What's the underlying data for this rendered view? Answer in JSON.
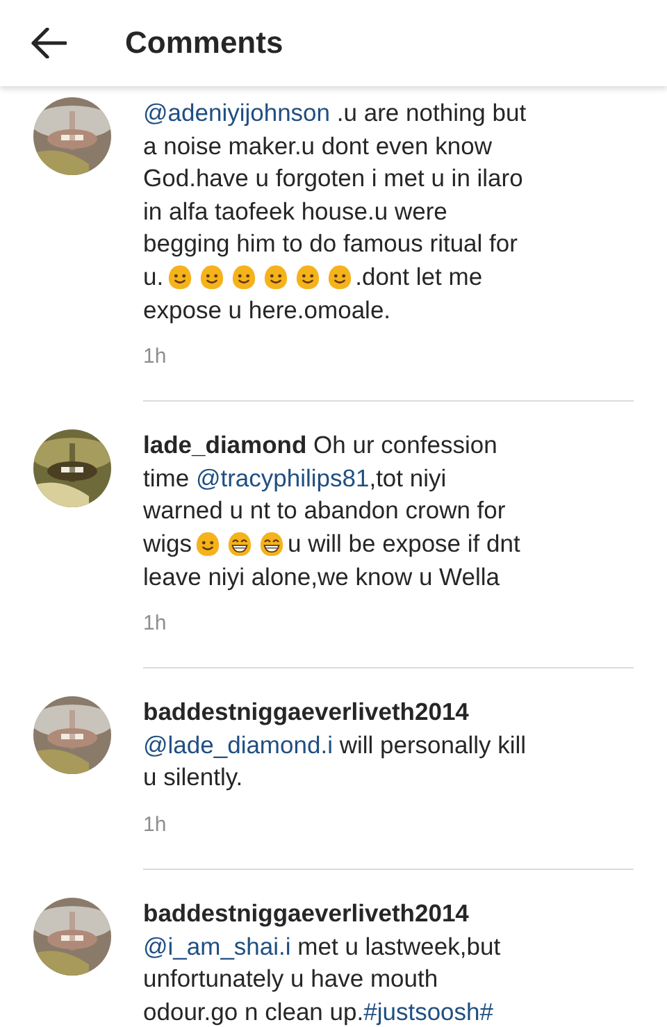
{
  "header": {
    "title": "Comments"
  },
  "comments": [
    {
      "lines": [
        [
          {
            "kind": "mention",
            "text": "@adeniyijohnson"
          },
          {
            "kind": "text",
            "text": " .u are nothing but"
          }
        ],
        [
          {
            "kind": "text",
            "text": "a noise maker.u dont even know"
          }
        ],
        [
          {
            "kind": "text",
            "text": "God.have u forgoten i met u in ilaro"
          }
        ],
        [
          {
            "kind": "text",
            "text": "in alfa taofeek house.u were"
          }
        ],
        [
          {
            "kind": "text",
            "text": "begging him to do famous ritual for"
          }
        ],
        [
          {
            "kind": "text",
            "text": "u."
          },
          {
            "kind": "smile"
          },
          {
            "kind": "smile"
          },
          {
            "kind": "smile"
          },
          {
            "kind": "smile"
          },
          {
            "kind": "smile"
          },
          {
            "kind": "smile"
          },
          {
            "kind": "text",
            "text": ".dont let me"
          }
        ],
        [
          {
            "kind": "text",
            "text": "expose u here.omoale."
          }
        ]
      ],
      "time": "1h"
    },
    {
      "lines": [
        [
          {
            "kind": "user",
            "text": "lade_diamond"
          },
          {
            "kind": "text",
            "text": " Oh ur confession"
          }
        ],
        [
          {
            "kind": "text",
            "text": "time "
          },
          {
            "kind": "mention",
            "text": "@tracyphilips81"
          },
          {
            "kind": "text",
            "text": ",tot niyi"
          }
        ],
        [
          {
            "kind": "text",
            "text": "warned u nt to abandon crown for"
          }
        ],
        [
          {
            "kind": "text",
            "text": "wigs"
          },
          {
            "kind": "smile"
          },
          {
            "kind": "grin"
          },
          {
            "kind": "grin"
          },
          {
            "kind": "text",
            "text": "u will be expose if dnt"
          }
        ],
        [
          {
            "kind": "text",
            "text": "leave niyi alone,we know u Wella"
          }
        ]
      ],
      "time": "1h"
    },
    {
      "lines": [
        [
          {
            "kind": "user",
            "text": "baddestniggaeverliveth2014"
          }
        ],
        [
          {
            "kind": "mention",
            "text": "@lade_diamond.i"
          },
          {
            "kind": "text",
            "text": " will personally kill"
          }
        ],
        [
          {
            "kind": "text",
            "text": "u silently."
          }
        ]
      ],
      "time": "1h"
    },
    {
      "lines": [
        [
          {
            "kind": "user",
            "text": "baddestniggaeverliveth2014"
          }
        ],
        [
          {
            "kind": "mention",
            "text": "@i_am_shai.i"
          },
          {
            "kind": "text",
            "text": " met u lastweek,but"
          }
        ],
        [
          {
            "kind": "text",
            "text": "unfortunately u have mouth"
          }
        ],
        [
          {
            "kind": "text",
            "text": "odour.go n clean up."
          },
          {
            "kind": "mention",
            "text": "#justsoosh#"
          }
        ]
      ]
    }
  ]
}
